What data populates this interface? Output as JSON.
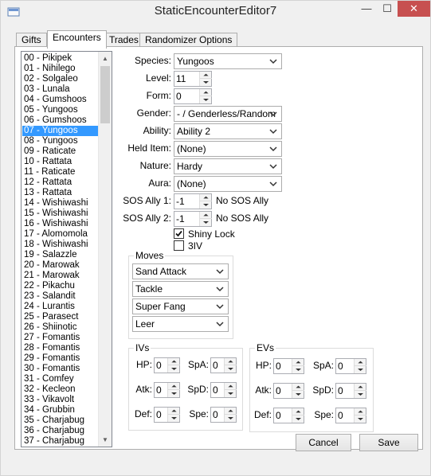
{
  "window": {
    "title": "StaticEncounterEditor7"
  },
  "titlebar": {
    "minimize": "—",
    "maximize": "☐",
    "close": "✕"
  },
  "tabs": [
    "Gifts",
    "Encounters",
    "Trades",
    "Randomizer Options"
  ],
  "list": {
    "selected_index": 7,
    "items": [
      "00 - Pikipek",
      "01 - Nihilego",
      "02 - Solgaleo",
      "03 - Lunala",
      "04 - Gumshoos",
      "05 - Yungoos",
      "06 - Gumshoos",
      "07 - Yungoos",
      "08 - Yungoos",
      "09 - Raticate",
      "10 - Rattata",
      "11 - Raticate",
      "12 - Rattata",
      "13 - Rattata",
      "14 - Wishiwashi",
      "15 - Wishiwashi",
      "16 - Wishiwashi",
      "17 - Alomomola",
      "18 - Wishiwashi",
      "19 - Salazzle",
      "20 - Marowak",
      "21 - Marowak",
      "22 - Pikachu",
      "23 - Salandit",
      "24 - Lurantis",
      "25 - Parasect",
      "26 - Shiinotic",
      "27 - Fomantis",
      "28 - Fomantis",
      "29 - Fomantis",
      "30 - Fomantis",
      "31 - Comfey",
      "32 - Kecleon",
      "33 - Vikavolt",
      "34 - Grubbin",
      "35 - Charjabug",
      "36 - Charjabug",
      "37 - Charjabug"
    ]
  },
  "form": {
    "species": {
      "label": "Species:",
      "value": "Yungoos"
    },
    "level": {
      "label": "Level:",
      "value": "11"
    },
    "form": {
      "label": "Form:",
      "value": "0"
    },
    "gender": {
      "label": "Gender:",
      "value": "- / Genderless/Random"
    },
    "ability": {
      "label": "Ability:",
      "value": "Ability 2"
    },
    "held_item": {
      "label": "Held Item:",
      "value": "(None)"
    },
    "nature": {
      "label": "Nature:",
      "value": "Hardy"
    },
    "aura": {
      "label": "Aura:",
      "value": "(None)"
    },
    "sos1": {
      "label": "SOS Ally 1:",
      "value": "-1",
      "desc": "No SOS Ally"
    },
    "sos2": {
      "label": "SOS Ally 2:",
      "value": "-1",
      "desc": "No SOS Ally"
    },
    "shiny_lock": {
      "label": "Shiny Lock",
      "checked": true
    },
    "three_iv": {
      "label": "3IV",
      "checked": false
    }
  },
  "moves": {
    "title": "Moves",
    "items": [
      "Sand Attack",
      "Tackle",
      "Super Fang",
      "Leer"
    ]
  },
  "ivs": {
    "title": "IVs",
    "hp": {
      "label": "HP:",
      "value": "0"
    },
    "atk": {
      "label": "Atk:",
      "value": "0"
    },
    "def": {
      "label": "Def:",
      "value": "0"
    },
    "spa": {
      "label": "SpA:",
      "value": "0"
    },
    "spd": {
      "label": "SpD:",
      "value": "0"
    },
    "spe": {
      "label": "Spe:",
      "value": "0"
    }
  },
  "evs": {
    "title": "EVs",
    "hp": {
      "label": "HP:",
      "value": "0"
    },
    "atk": {
      "label": "Atk:",
      "value": "0"
    },
    "def": {
      "label": "Def:",
      "value": "0"
    },
    "spa": {
      "label": "SpA:",
      "value": "0"
    },
    "spd": {
      "label": "SpD:",
      "value": "0"
    },
    "spe": {
      "label": "Spe:",
      "value": "0"
    }
  },
  "buttons": {
    "cancel": "Cancel",
    "save": "Save"
  }
}
